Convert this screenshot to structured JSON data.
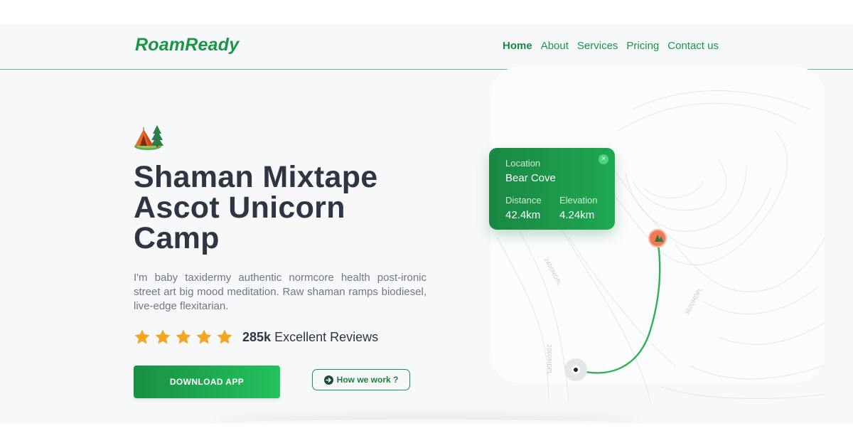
{
  "header": {
    "logo": "RoamReady",
    "nav": [
      {
        "label": "Home",
        "active": true
      },
      {
        "label": "About"
      },
      {
        "label": "Services"
      },
      {
        "label": "Pricing"
      },
      {
        "label": "Contact us"
      }
    ]
  },
  "hero": {
    "icon": "camping-tent-icon",
    "title_lines": [
      "Shaman Mixtape",
      "Ascot Unicorn",
      "Camp"
    ],
    "description": "I'm baby taxidermy authentic normcore health post-ironic street art big mood meditation. Raw shaman ramps biodiesel, live-edge flexitarian.",
    "rating": {
      "stars": 5,
      "count": "285k",
      "label": "Excellent Reviews"
    },
    "download_label": "DOWNLOAD APP",
    "how_label": "How we work ?"
  },
  "map": {
    "card": {
      "location_label": "Location",
      "location_value": "Bear Cove",
      "distance_label": "Distance",
      "distance_value": "42.4km",
      "elevation_label": "Elevation",
      "elevation_value": "4.24km",
      "close": "×"
    },
    "contour_labels": [
      "2400MDPL",
      "3600MDPL",
      "2000MDPL"
    ]
  },
  "colors": {
    "brand": "#1a9647",
    "accent_orange": "#f4a623",
    "pin": "#f07a55",
    "title": "#2f3542"
  }
}
